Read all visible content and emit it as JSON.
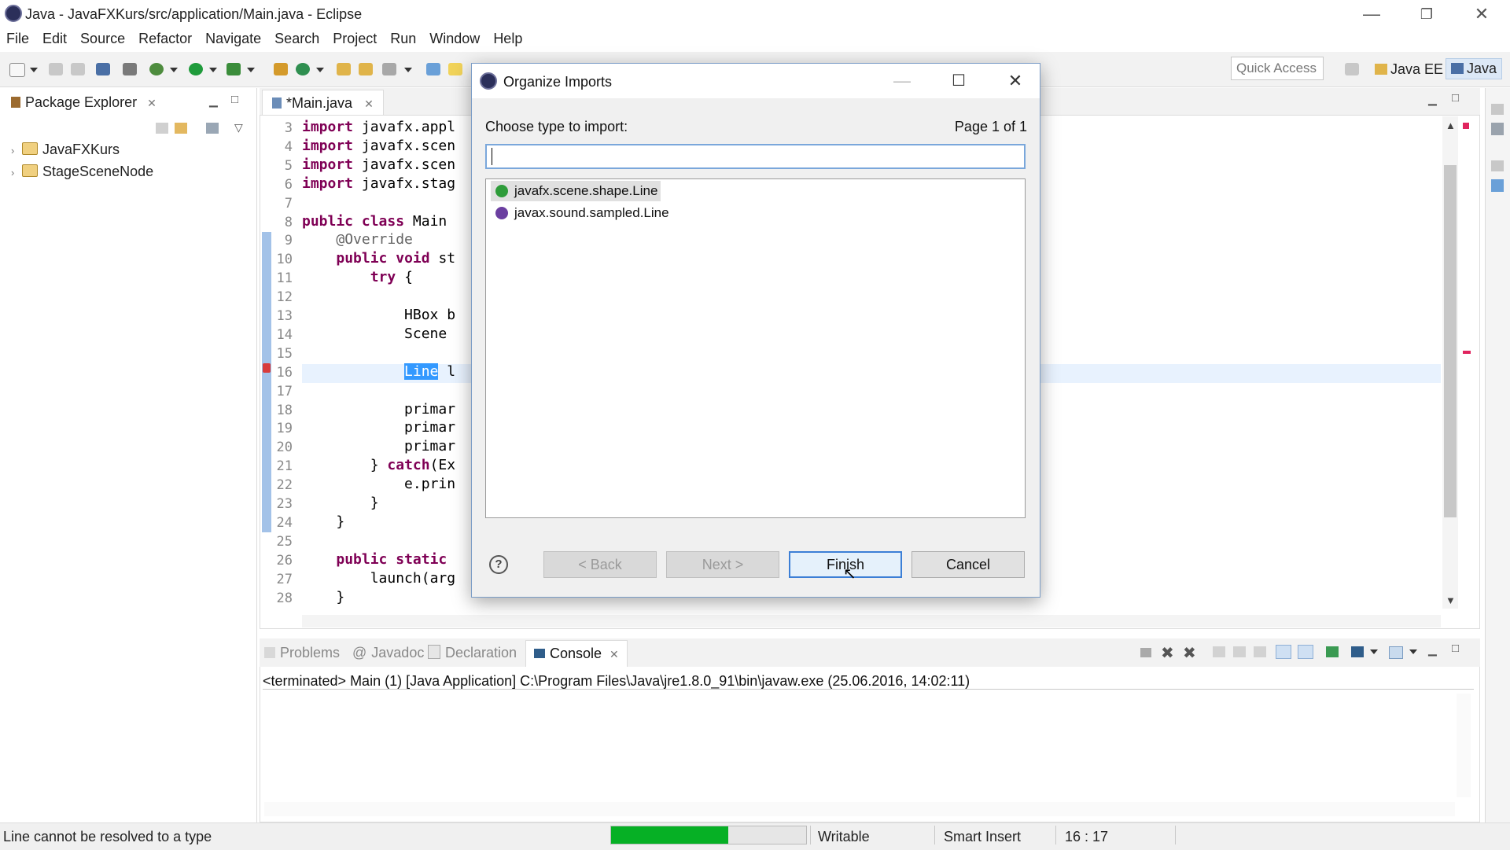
{
  "window": {
    "title": "Java - JavaFXKurs/src/application/Main.java - Eclipse"
  },
  "menu": [
    "File",
    "Edit",
    "Source",
    "Refactor",
    "Navigate",
    "Search",
    "Project",
    "Run",
    "Window",
    "Help"
  ],
  "toolbar": {
    "quick_access": "Quick Access",
    "perspectives": [
      "Java EE",
      "Java"
    ]
  },
  "package_explorer": {
    "tab_label": "Package Explorer",
    "projects": [
      "JavaFXKurs",
      "StageSceneNode"
    ]
  },
  "editor": {
    "tab_label": "*Main.java",
    "lines": [
      {
        "n": "3",
        "text": "import javafx.appl"
      },
      {
        "n": "4",
        "text": "import javafx.scen"
      },
      {
        "n": "5",
        "text": "import javafx.scen"
      },
      {
        "n": "6",
        "text": "import javafx.stag"
      },
      {
        "n": "7",
        "text": ""
      },
      {
        "n": "8",
        "text": "public class Main "
      },
      {
        "n": "9",
        "text": "    @Override"
      },
      {
        "n": "10",
        "text": "    public void st"
      },
      {
        "n": "11",
        "text": "        try {"
      },
      {
        "n": "12",
        "text": ""
      },
      {
        "n": "13",
        "text": "            HBox b"
      },
      {
        "n": "14",
        "text": "            Scene "
      },
      {
        "n": "15",
        "text": ""
      },
      {
        "n": "16",
        "text": "            Line l"
      },
      {
        "n": "17",
        "text": ""
      },
      {
        "n": "18",
        "text": "            primar"
      },
      {
        "n": "19",
        "text": "            primar"
      },
      {
        "n": "20",
        "text": "            primar"
      },
      {
        "n": "21",
        "text": "        } catch(Ex"
      },
      {
        "n": "22",
        "text": "            e.prin"
      },
      {
        "n": "23",
        "text": "        }"
      },
      {
        "n": "24",
        "text": "    }"
      },
      {
        "n": "25",
        "text": ""
      },
      {
        "n": "26",
        "text": "    public static "
      },
      {
        "n": "27",
        "text": "        launch(arg"
      },
      {
        "n": "28",
        "text": "    }"
      }
    ],
    "highlighted_word": "Line"
  },
  "bottom_views": {
    "tabs": [
      "Problems",
      "Javadoc",
      "Declaration",
      "Console"
    ],
    "active_tab": "Console",
    "console_line": "<terminated> Main (1) [Java Application] C:\\Program Files\\Java\\jre1.8.0_91\\bin\\javaw.exe (25.06.2016, 14:02:11)"
  },
  "status": {
    "message": "Line cannot be resolved to a type",
    "progress": 0.6,
    "writable": "Writable",
    "insert_mode": "Smart Insert",
    "position": "16 : 17"
  },
  "dialog": {
    "title": "Organize Imports",
    "prompt": "Choose type to import:",
    "page": "Page 1 of 1",
    "input_value": "",
    "types": [
      {
        "name": "javafx.scene.shape.Line",
        "kind": "class",
        "color": "#2e9c3a",
        "selected": true
      },
      {
        "name": "javax.sound.sampled.Line",
        "kind": "interface",
        "color": "#6b3fa0",
        "selected": false
      }
    ],
    "buttons": {
      "back": "< Back",
      "next": "Next >",
      "finish": "Finish",
      "cancel": "Cancel"
    },
    "help": "?"
  }
}
